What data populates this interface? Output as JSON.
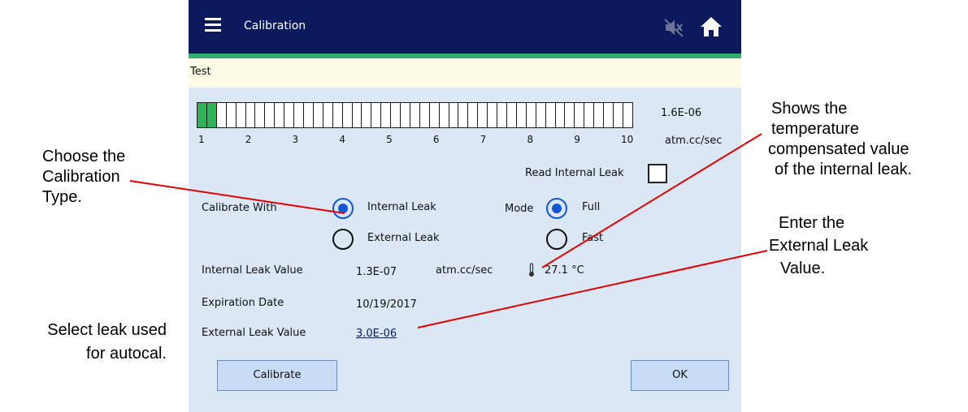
{
  "header": {
    "title": "Calibration",
    "mute_icon": "mute-icon",
    "home_icon": "home-icon",
    "menu_icon": "hamburger-menu-icon",
    "bg": "#0a1a5c",
    "accent": "#2cb36a"
  },
  "status": {
    "text": "Test"
  },
  "leak_bar": {
    "segments_total": 45,
    "segments_lit": 2,
    "ticks": [
      "1",
      "2",
      "3",
      "4",
      "5",
      "6",
      "7",
      "8",
      "9",
      "10"
    ],
    "reading": "1.6E-06",
    "unit": "atm.cc/sec"
  },
  "form": {
    "read_internal_leak": {
      "label": "Read Internal Leak",
      "checked": false
    },
    "calibrate_with_label": "Calibrate With",
    "options": [
      {
        "label": "Internal Leak",
        "selected": true
      },
      {
        "label": "External Leak",
        "selected": false
      }
    ],
    "mode_label": "Mode",
    "modes": [
      {
        "label": "Full",
        "selected": true
      },
      {
        "label": "Fast",
        "selected": false
      }
    ],
    "internal_leak_label": "Internal Leak Value",
    "internal_leak_value": "1.3E-07",
    "internal_leak_unit": "atm.cc/sec",
    "temperature_icon": "thermometer-icon",
    "temperature": "27.1 °C",
    "expiration_label": "Expiration Date",
    "expiration_value": "10/19/2017",
    "external_leak_label": "External Leak Value",
    "external_leak_value": "3.0E-06"
  },
  "buttons": {
    "calibrate": "Calibrate",
    "ok": "OK"
  },
  "annotations": {
    "choose_type": [
      "Choose the",
      "Calibration",
      "Type."
    ],
    "select_leak": [
      "Select leak used",
      "for autocal."
    ],
    "shows_temp": [
      "Shows the",
      "temperature",
      "compensated value",
      "of the internal leak."
    ],
    "enter_external": [
      "Enter the",
      "External Leak",
      "Value."
    ]
  }
}
